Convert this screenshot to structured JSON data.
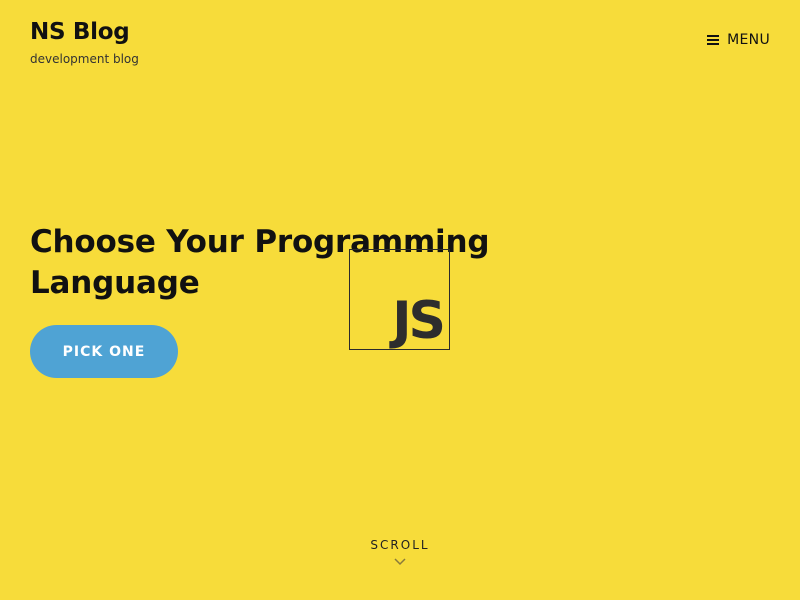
{
  "header": {
    "site_title": "NS Blog",
    "tagline": "development blog",
    "menu_label": "MENU",
    "menu_icon": "hamburger-icon"
  },
  "hero": {
    "title": "Choose Your Programming Language",
    "cta_label": "PICK ONE",
    "cta_color": "#4fa3d4",
    "logo_text": "JS"
  },
  "scroll": {
    "label": "SCROLL",
    "icon": "chevron-down-icon"
  },
  "colors": {
    "background": "#f7dc3a",
    "text": "#111111"
  }
}
